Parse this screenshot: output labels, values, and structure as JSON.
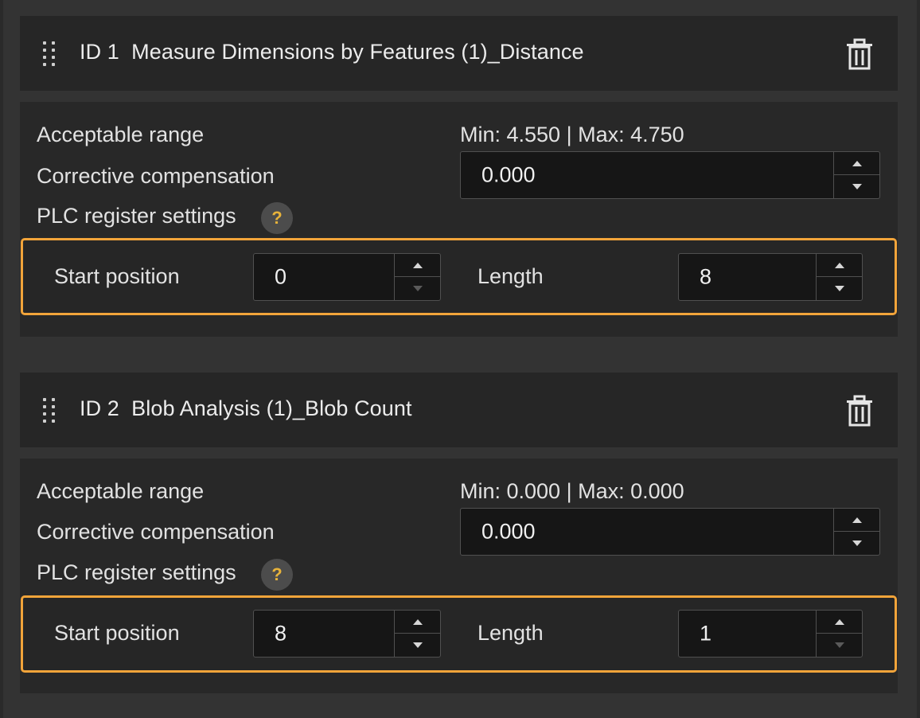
{
  "colors": {
    "highlight": "#f2a43a",
    "help_glyph": "#e8b33a",
    "panel_bg": "#282828",
    "header_bg": "#262626"
  },
  "items": [
    {
      "title": "ID 1  Measure Dimensions by Features (1)_Distance",
      "drag_icon": "drag-handle-icon",
      "delete_icon": "trash-icon",
      "acceptable_range_label": "Acceptable range",
      "acceptable_range_value": "Min: 4.550 | Max: 4.750",
      "compensation_label": "Corrective compensation",
      "compensation_value": "0.000",
      "plc_label": "PLC register settings",
      "help_glyph": "?",
      "start_label": "Start position",
      "start_value": "0",
      "length_label": "Length",
      "length_value": "8"
    },
    {
      "title": "ID 2  Blob Analysis (1)_Blob Count",
      "drag_icon": "drag-handle-icon",
      "delete_icon": "trash-icon",
      "acceptable_range_label": "Acceptable range",
      "acceptable_range_value": "Min: 0.000 | Max: 0.000",
      "compensation_label": "Corrective compensation",
      "compensation_value": "0.000",
      "plc_label": "PLC register settings",
      "help_glyph": "?",
      "start_label": "Start position",
      "start_value": "8",
      "length_label": "Length",
      "length_value": "1"
    }
  ]
}
